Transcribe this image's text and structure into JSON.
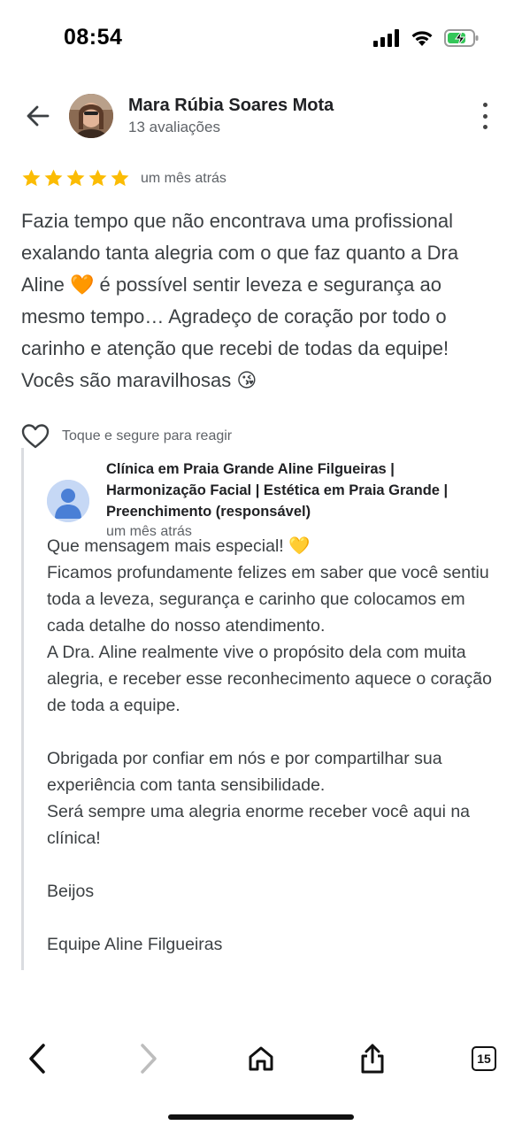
{
  "status_bar": {
    "time": "08:54"
  },
  "reviewer": {
    "name": "Mara Rúbia Soares Mota",
    "meta": "13 avaliações"
  },
  "review": {
    "rating": 5,
    "time": "um mês atrás",
    "text": "Fazia tempo que não encontrava uma profissional exalando tanta alegria com o que faz quanto a Dra Aline 🧡 é possível sentir leveza e segurança ao mesmo tempo… Agradeço de coração por todo o carinho e atenção que recebi de todas da equipe! Vocês são maravilhosas 😘"
  },
  "react": {
    "label": "Toque e segure para reagir"
  },
  "owner_reply": {
    "name": "Clínica em Praia Grande Aline Filgueiras | Harmonização Facial | Estética em Praia Grande | Preenchimento (responsável)",
    "time": "um mês atrás",
    "paragraphs": [
      "Que mensagem mais especial! 💛\nFicamos profundamente felizes em saber que você sentiu toda a leveza, segurança e carinho que colocamos em cada detalhe do nosso atendimento.\nA Dra. Aline realmente vive o propósito dela com muita alegria, e receber esse reconhecimento aquece o coração de toda a equipe.",
      "Obrigada por confiar em nós e por compartilhar sua experiência com tanta sensibilidade.\nSerá sempre uma alegria enorme receber você aqui na clínica!",
      "Beijos",
      "Equipe Aline Filgueiras"
    ]
  },
  "browser_toolbar": {
    "tab_count": "15"
  },
  "colors": {
    "star": "#fbbc04",
    "text_secondary": "#5f6368",
    "battery_green": "#34c759"
  }
}
